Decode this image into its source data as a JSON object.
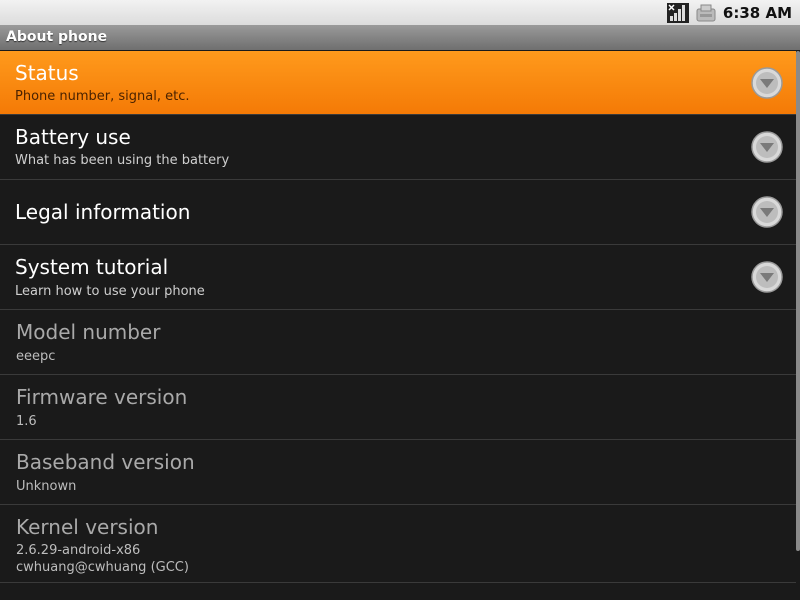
{
  "status_bar": {
    "time": "6:38 AM",
    "icons": [
      "signal-icon",
      "ethernet-icon"
    ]
  },
  "title": "About phone",
  "items": [
    {
      "title": "Status",
      "summary": "Phone number, signal, etc.",
      "has_arrow": true,
      "selected": true,
      "enabled": true
    },
    {
      "title": "Battery use",
      "summary": "What has been using the battery",
      "has_arrow": true,
      "selected": false,
      "enabled": true
    },
    {
      "title": "Legal information",
      "summary": "",
      "has_arrow": true,
      "selected": false,
      "enabled": true
    },
    {
      "title": "System tutorial",
      "summary": "Learn how to use your phone",
      "has_arrow": true,
      "selected": false,
      "enabled": true
    },
    {
      "title": "Model number",
      "summary": "eeepc",
      "has_arrow": false,
      "selected": false,
      "enabled": false
    },
    {
      "title": "Firmware version",
      "summary": "1.6",
      "has_arrow": false,
      "selected": false,
      "enabled": false
    },
    {
      "title": "Baseband version",
      "summary": "Unknown",
      "has_arrow": false,
      "selected": false,
      "enabled": false
    },
    {
      "title": "Kernel version",
      "summary": "2.6.29-android-x86",
      "summary2": "cwhuang@cwhuang (GCC)",
      "has_arrow": false,
      "selected": false,
      "enabled": false
    }
  ],
  "colors": {
    "selected": "#f58a0e",
    "background": "#1a1a1a"
  }
}
